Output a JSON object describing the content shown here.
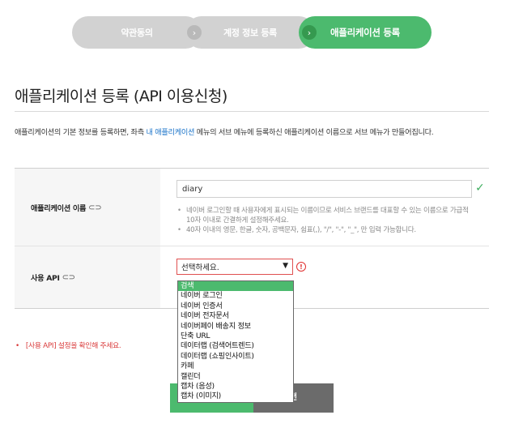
{
  "steps": {
    "items": [
      {
        "label": "약관동의"
      },
      {
        "label": "계정 정보 등록"
      },
      {
        "label": "애플리케이션 등록"
      }
    ],
    "chevron": "›"
  },
  "page": {
    "title": "애플리케이션 등록 (API 이용신청)",
    "description_prefix": "애플리케이션의 기본 정보를 등록하면, 좌측 ",
    "description_link": "내 애플리케이션",
    "description_suffix": " 메뉴의 서브 메뉴에 등록하신 애플리케이션 이름으로 서브 메뉴가 만들어집니다."
  },
  "form": {
    "app_name": {
      "label": "애플리케이션 이름",
      "value": "diary",
      "hints": [
        "네이버 로그인할 때 사용자에게 표시되는 이름이므로 서비스 브랜드를 대표할 수 있는 이름으로 가급적 10자 이내로 간결하게 설정해주세요.",
        "40자 이내의 영문, 한글, 숫자, 공백문자, 쉼표(,), \"/\", \"-\", \"_\", 만 입력 가능합니다."
      ]
    },
    "api": {
      "label": "사용 API",
      "selected": "선택하세요.",
      "options": [
        "검색",
        "네이버 로그인",
        "네이버 인증서",
        "네이버 전자문서",
        "네이버페이 배송지 정보",
        "단축 URL",
        "데이터랩 (검색어트렌드)",
        "데이터랩 (쇼핑인사이트)",
        "카페",
        "캘린더",
        "캡차 (음성)",
        "캡차 (이미지)"
      ],
      "highlighted_index": 0
    },
    "error": "[사용 API] 설정을 확인해 주세요."
  },
  "buttons": {
    "right_label": "전"
  },
  "colors": {
    "accent": "#4cba6e",
    "error": "#d93a3a",
    "link": "#1a73c9"
  }
}
